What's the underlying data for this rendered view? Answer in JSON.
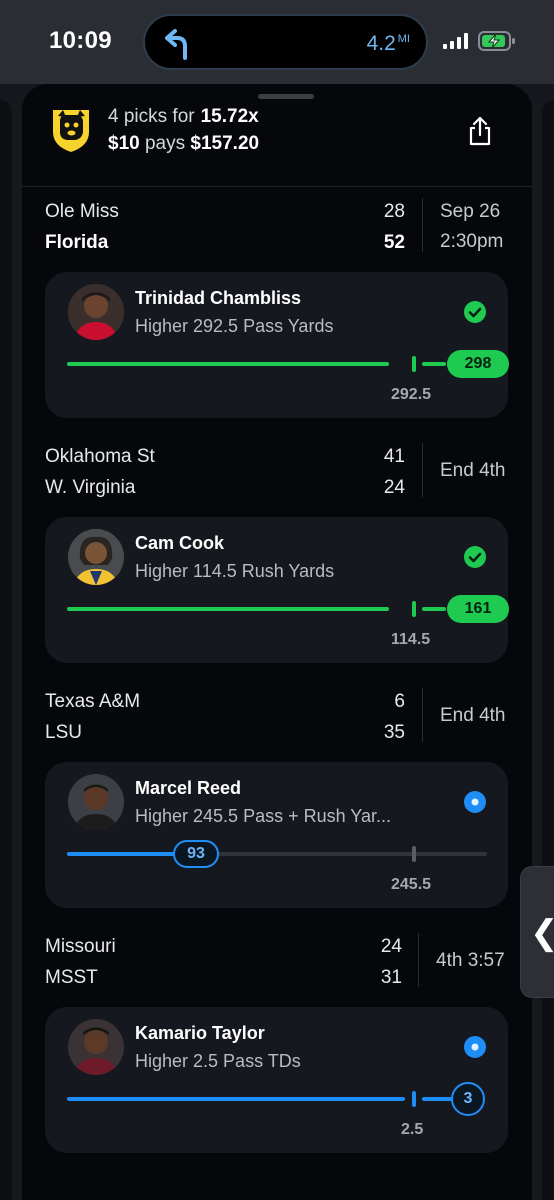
{
  "status_bar": {
    "time": "10:09",
    "distance": "4.2",
    "distance_unit": "MI",
    "nav_icon": "turn-left-arrow-icon"
  },
  "header": {
    "picks_prefix": "4 picks for",
    "multiplier": "15.72x",
    "stake": "$10",
    "pays_word": "pays",
    "payout": "$157.20",
    "share_icon": "share-icon"
  },
  "games": [
    {
      "team1": "Ole Miss",
      "score1": "28",
      "team2": "Florida",
      "score2": "52",
      "winner": 2,
      "status_line1": "Sep 26",
      "status_line2": "2:30pm",
      "pick": {
        "player": "Trinidad Chambliss",
        "line_text": "Higher 292.5 Pass Yards",
        "line": "292.5",
        "current": "298",
        "state": "won",
        "color": "#1fca51"
      }
    },
    {
      "team1": "Oklahoma St",
      "score1": "41",
      "team2": "W. Virginia",
      "score2": "24",
      "winner": 0,
      "status_line1": "End 4th",
      "status_line2": "",
      "pick": {
        "player": "Cam Cook",
        "line_text": "Higher 114.5 Rush Yards",
        "line": "114.5",
        "current": "161",
        "state": "won",
        "color": "#1fca51"
      }
    },
    {
      "team1": "Texas A&M",
      "score1": "6",
      "team2": "LSU",
      "score2": "35",
      "winner": 0,
      "status_line1": "End 4th",
      "status_line2": "",
      "pick": {
        "player": "Marcel Reed",
        "line_text": "Higher 245.5 Pass + Rush Yar...",
        "line": "245.5",
        "current": "93",
        "state": "live",
        "progress_fraction": 0.38,
        "color": "#1f8df6"
      }
    },
    {
      "team1": "Missouri",
      "score1": "24",
      "team2": "MSST",
      "score2": "31",
      "winner": 0,
      "status_line1": "4th 3:57",
      "status_line2": "",
      "pick": {
        "player": "Kamario Taylor",
        "line_text": "Higher 2.5 Pass TDs",
        "line": "2.5",
        "current": "3",
        "state": "live",
        "color": "#1f8df6"
      }
    }
  ]
}
